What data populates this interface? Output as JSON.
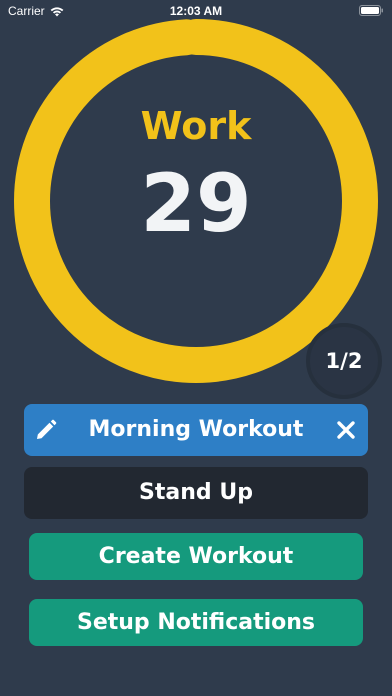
{
  "status_bar": {
    "carrier": "Carrier",
    "time": "12:03 AM",
    "icons": [
      "wifi-icon",
      "battery-icon"
    ]
  },
  "timer": {
    "phase": "Work",
    "remaining": "29",
    "progress": 0.99,
    "color": "#f2c21a"
  },
  "round_counter": {
    "text": "1/2"
  },
  "workout_bar": {
    "name": "Morning Workout",
    "edit_icon": "pencil-icon",
    "close_icon": "close-icon",
    "color": "#2e7fc6"
  },
  "buttons": {
    "stand_up": "Stand Up",
    "create_workout": "Create Workout",
    "setup_notifications": "Setup Notifications",
    "accent": "#159a7d"
  },
  "colors": {
    "background": "#2f3b4c",
    "dark_button": "#222831"
  }
}
